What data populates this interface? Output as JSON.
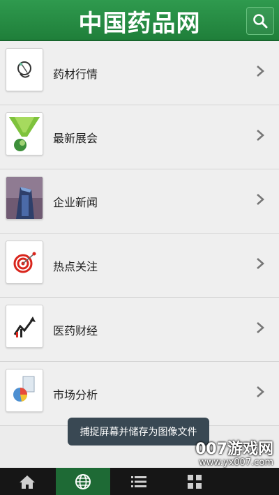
{
  "header": {
    "title": "中国药品网"
  },
  "menu": [
    {
      "label": "药材行情",
      "icon": "herb-icon"
    },
    {
      "label": "最新展会",
      "icon": "exhibition-icon"
    },
    {
      "label": "企业新闻",
      "icon": "building-icon"
    },
    {
      "label": "热点关注",
      "icon": "target-icon"
    },
    {
      "label": "医药财经",
      "icon": "finance-chart-icon"
    },
    {
      "label": "市场分析",
      "icon": "pie-chart-icon"
    }
  ],
  "toast": {
    "text": "捕捉屏幕并储存为图像文件"
  },
  "tabbar": [
    {
      "icon": "home-icon",
      "active": false
    },
    {
      "icon": "globe-icon",
      "active": true
    },
    {
      "icon": "list-icon",
      "active": false
    },
    {
      "icon": "grid-icon",
      "active": false
    }
  ],
  "watermark": {
    "brand": "007游戏网",
    "url": "www.yx007.com"
  },
  "colors": {
    "header": "#228540",
    "tab_active": "#1e6a35",
    "tabbar": "#161616"
  }
}
